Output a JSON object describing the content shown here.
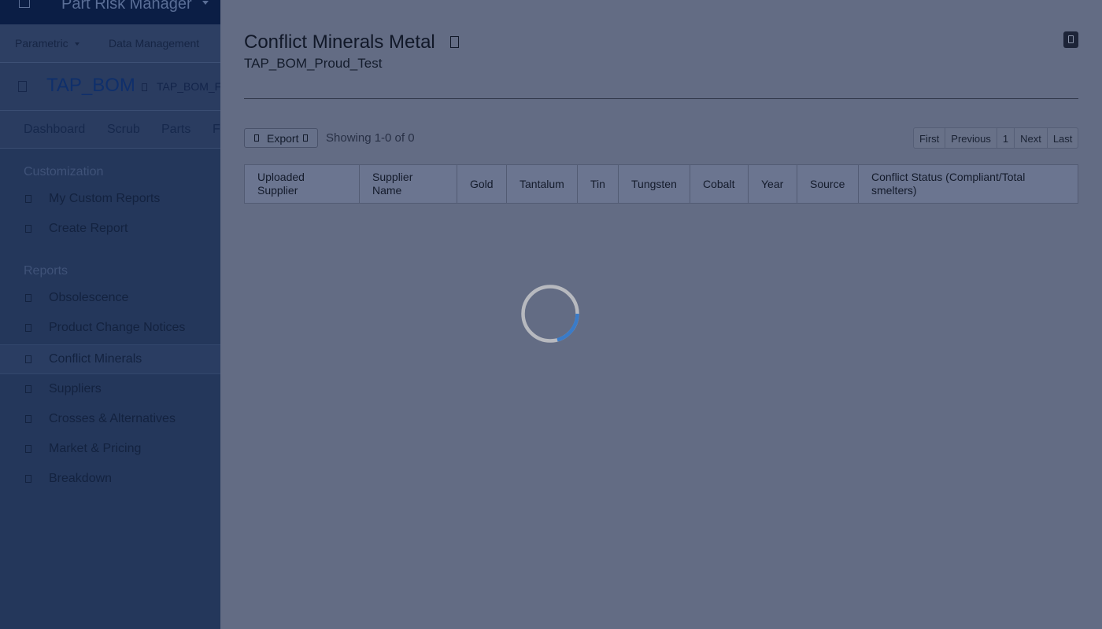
{
  "app": {
    "title": "Part Risk Manager"
  },
  "subnav": {
    "parametric": "Parametric",
    "data_management": "Data Management"
  },
  "bom": {
    "title": "TAP_BOM",
    "subtitle": "TAP_BOM_F"
  },
  "tabs": [
    "Dashboard",
    "Scrub",
    "Parts",
    "F"
  ],
  "sidebar": {
    "customization_heading": "Customization",
    "customization_items": [
      "My Custom Reports",
      "Create Report"
    ],
    "reports_heading": "Reports",
    "report_items": [
      "Obsolescence",
      "Product Change Notices",
      "Conflict Minerals",
      "Suppliers",
      "Crosses & Alternatives",
      "Market & Pricing",
      "Breakdown"
    ],
    "active_item": "Conflict Minerals"
  },
  "modal": {
    "title": "Conflict Minerals Metal",
    "subtitle": "TAP_BOM_Proud_Test",
    "export_label": "Export",
    "showing_text": "Showing 1-0 of 0",
    "pagination": [
      "First",
      "Previous",
      "1",
      "Next",
      "Last"
    ],
    "columns": [
      "Uploaded Supplier",
      "Supplier Name",
      "Gold",
      "Tantalum",
      "Tin",
      "Tungsten",
      "Cobalt",
      "Year",
      "Source",
      "Conflict Status (Compliant/Total smelters)"
    ],
    "icons": {
      "title_icon": "copy-icon",
      "close_icon": "close-icon",
      "export_left_icon": "file-icon",
      "export_right_icon": "chevron-down-icon"
    }
  },
  "loading": {
    "state": "loading",
    "icon": "loading-spinner",
    "accent": "#3a7bc8"
  }
}
